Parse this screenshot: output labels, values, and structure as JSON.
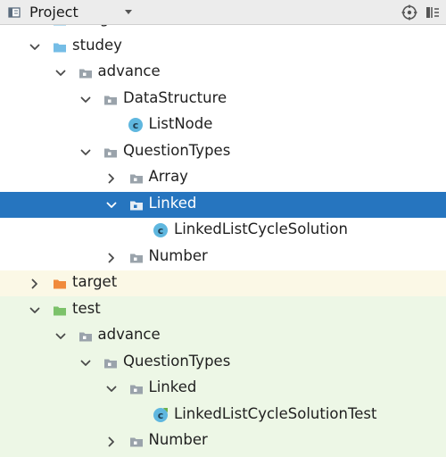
{
  "toolbar": {
    "title": "Project"
  },
  "tree": {
    "items": [
      {
        "label": "image",
        "depth": 1,
        "chevron": "none",
        "icon": "folder-blue"
      },
      {
        "label": "studey",
        "depth": 1,
        "chevron": "down",
        "icon": "folder-blue"
      },
      {
        "label": "advance",
        "depth": 2,
        "chevron": "down",
        "icon": "package"
      },
      {
        "label": "DataStructure",
        "depth": 3,
        "chevron": "down",
        "icon": "package"
      },
      {
        "label": "ListNode",
        "depth": 4,
        "chevron": "none",
        "icon": "class"
      },
      {
        "label": "QuestionTypes",
        "depth": 3,
        "chevron": "down",
        "icon": "package"
      },
      {
        "label": "Array",
        "depth": 4,
        "chevron": "right",
        "icon": "package"
      },
      {
        "label": "Linked",
        "depth": 4,
        "chevron": "down",
        "icon": "package",
        "selected": true
      },
      {
        "label": "LinkedListCycleSolution",
        "depth": 5,
        "chevron": "none",
        "icon": "class"
      },
      {
        "label": "Number",
        "depth": 4,
        "chevron": "right",
        "icon": "package"
      },
      {
        "label": "target",
        "depth": 1,
        "chevron": "right",
        "icon": "folder-orange"
      },
      {
        "label": "test",
        "depth": 1,
        "chevron": "down",
        "icon": "folder-green"
      },
      {
        "label": "advance",
        "depth": 2,
        "chevron": "down",
        "icon": "package"
      },
      {
        "label": "QuestionTypes",
        "depth": 3,
        "chevron": "down",
        "icon": "package"
      },
      {
        "label": "Linked",
        "depth": 4,
        "chevron": "down",
        "icon": "package"
      },
      {
        "label": "LinkedListCycleSolutionTest",
        "depth": 5,
        "chevron": "none",
        "icon": "test-class"
      },
      {
        "label": "Number",
        "depth": 4,
        "chevron": "right",
        "icon": "package"
      }
    ]
  },
  "colors": {
    "selection": "#2675bf",
    "folder_blue": "#75bde6",
    "folder_orange": "#f08a3c",
    "folder_green": "#7cc26a",
    "package": "#9aa3ab",
    "class_icon": "#5fb7df"
  }
}
